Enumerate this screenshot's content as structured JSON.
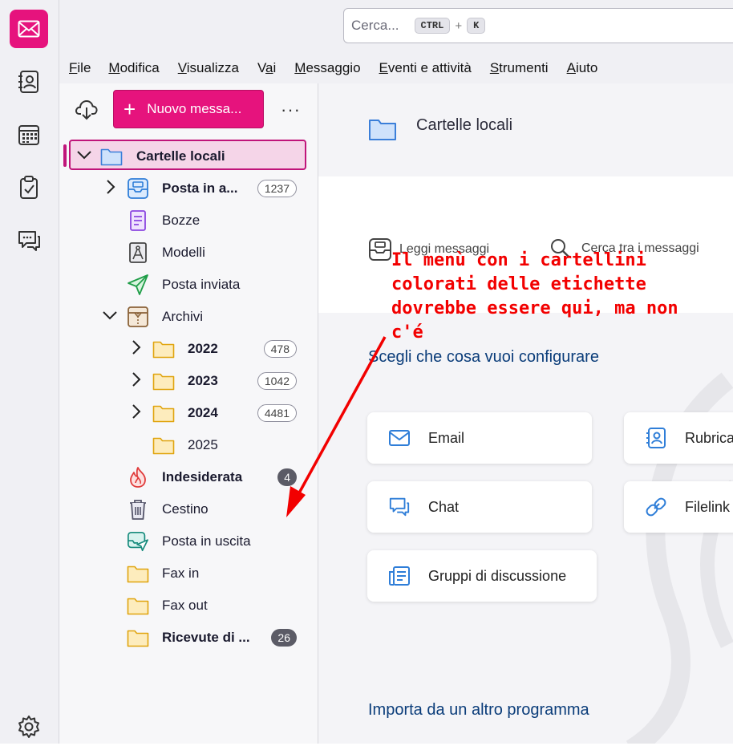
{
  "spaces": {
    "mail_icon": "envelope-icon",
    "items": [
      "address-book-icon",
      "calendar-icon",
      "tasks-icon",
      "chat-icon"
    ],
    "settings_icon": "gear-icon"
  },
  "search": {
    "placeholder": "Cerca...",
    "key1": "CTRL",
    "plus": "+",
    "key2": "K"
  },
  "menubar": [
    {
      "label": "File",
      "u": "F",
      "rest": "ile"
    },
    {
      "label": "Modifica",
      "u": "M",
      "rest": "odifica"
    },
    {
      "label": "Visualizza",
      "u": "V",
      "rest": "isualizza"
    },
    {
      "label": "Vai",
      "pre": "V",
      "u": "a",
      "rest": "i"
    },
    {
      "label": "Messaggio",
      "u": "M",
      "rest": "essaggio"
    },
    {
      "label": "Eventi e attività",
      "u": "E",
      "rest": "venti e attività"
    },
    {
      "label": "Strumenti",
      "u": "S",
      "rest": "trumenti"
    },
    {
      "label": "Aiuto",
      "u": "A",
      "rest": "iuto"
    }
  ],
  "folderpane": {
    "new_message": "Nuovo messa...",
    "more": "···",
    "account": "Cartelle locali",
    "folders": [
      {
        "name": "Posta in a...",
        "bold": true,
        "count": "1237"
      },
      {
        "name": "Bozze"
      },
      {
        "name": "Modelli"
      },
      {
        "name": "Posta inviata"
      },
      {
        "name": "Archivi"
      },
      {
        "name": "2022",
        "bold": true,
        "count": "478"
      },
      {
        "name": "2023",
        "bold": true,
        "count": "1042"
      },
      {
        "name": "2024",
        "bold": true,
        "count": "4481"
      },
      {
        "name": "2025"
      },
      {
        "name": "Indesiderata",
        "bold": true,
        "count": "4"
      },
      {
        "name": "Cestino"
      },
      {
        "name": "Posta in uscita"
      },
      {
        "name": "Fax in"
      },
      {
        "name": "Fax out"
      },
      {
        "name": "Ricevute di ...",
        "bold": true,
        "count": "26"
      }
    ]
  },
  "content": {
    "title": "Cartelle locali",
    "read_messages": "Leggi messaggi",
    "search_messages": "Cerca tra i messaggi",
    "configure_title": "Scegli che cosa vuoi configurare",
    "cards": {
      "email": "Email",
      "address_book": "Rubrica",
      "chat": "Chat",
      "filelink": "Filelink",
      "newsgroups": "Gruppi di discussione"
    },
    "import_title": "Importa da un altro programma"
  },
  "annotation": {
    "text": "Il menù con i cartellini colorati delle etichette dovrebbe essere qui, ma non c'é",
    "color": "#f20000"
  },
  "colors": {
    "accent": "#e6137d",
    "selection": "#f5d5e8",
    "heading": "#0b3d7a"
  }
}
